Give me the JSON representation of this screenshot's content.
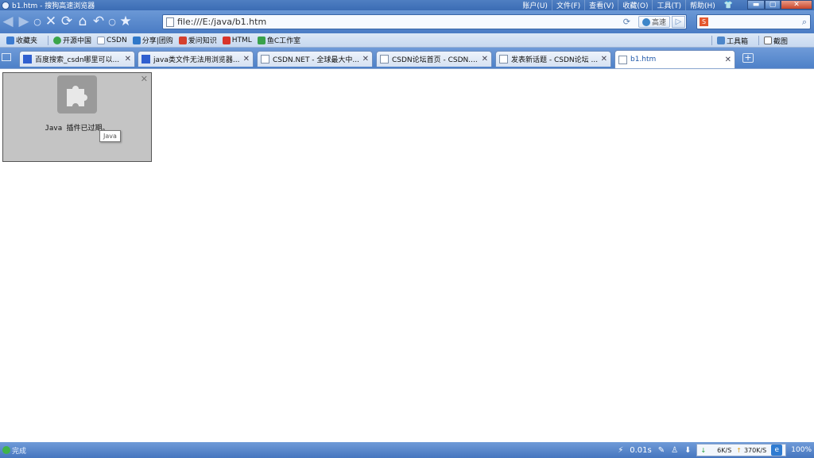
{
  "window": {
    "title": "b1.htm - 搜狗高速浏览器",
    "menu": [
      "账户(U)",
      "文件(F)",
      "查看(V)",
      "收藏(O)",
      "工具(T)",
      "帮助(H)"
    ],
    "controls": {
      "minimize": "▬",
      "maximize": "▢",
      "close": "✕"
    }
  },
  "toolbar": {
    "address": "file:///E:/java/b1.htm",
    "speed_label": "高速",
    "search_value": "",
    "icons": [
      "back-icon",
      "forward-icon",
      "dot-icon",
      "stop-icon",
      "refresh-icon",
      "home-icon",
      "undo-icon",
      "dot-icon",
      "star-icon"
    ]
  },
  "favorites": {
    "items": [
      {
        "label": "收藏夹",
        "icon_color": "#3c7bd0"
      },
      {
        "label": "开源中国",
        "icon_color": "#3aa54a"
      },
      {
        "label": "CSDN",
        "icon_color": "#8a9bb5"
      },
      {
        "label": "分享|团购",
        "icon_color": "#2f78c9"
      },
      {
        "label": "爱问知识",
        "icon_color": "#d4402e"
      },
      {
        "label": "HTML",
        "icon_color": "#d9342b"
      },
      {
        "label": "鱼C工作室",
        "icon_color": "#39a14b"
      }
    ],
    "right": [
      {
        "label": "工具箱"
      },
      {
        "label": "截图"
      }
    ]
  },
  "tabs": [
    {
      "label": "百度搜索_csdn哪里可以...",
      "active": false,
      "icon": "baidu"
    },
    {
      "label": "java类文件无法用浏览器...",
      "active": false,
      "icon": "baidu"
    },
    {
      "label": "CSDN.NET - 全球最大中...",
      "active": false,
      "icon": "page"
    },
    {
      "label": "CSDN论坛首页 - CSDN....",
      "active": false,
      "icon": "page"
    },
    {
      "label": "发表新话题 - CSDN论坛 ...",
      "active": false,
      "icon": "page"
    },
    {
      "label": "b1.htm",
      "active": true,
      "icon": "page"
    }
  ],
  "content": {
    "plugin_message": "Java 插件已过期。",
    "tooltip": "Java"
  },
  "status": {
    "text": "完成",
    "timer": "0.01s",
    "down_speed": "6K/S",
    "up_speed": "370K/S",
    "zoom": "100%"
  }
}
